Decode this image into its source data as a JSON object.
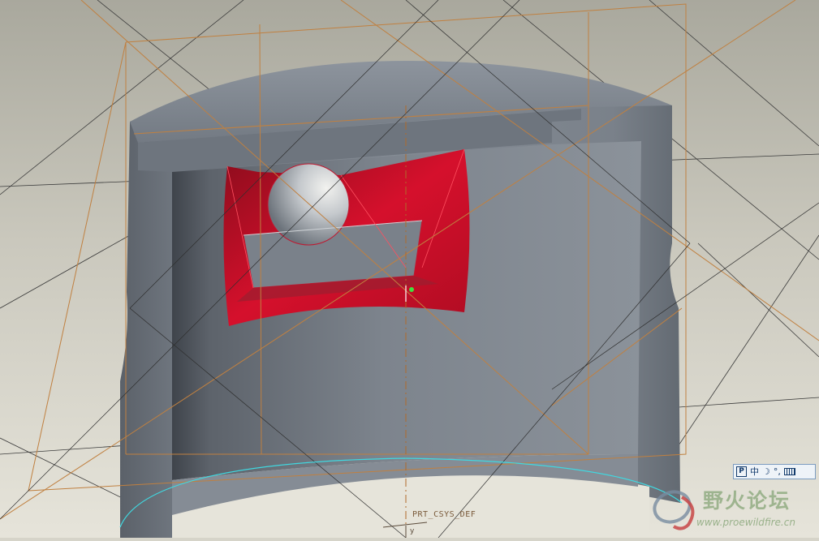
{
  "viewport": {
    "background": "#d6d4c9",
    "model_color": "#7f8791",
    "highlight_color": "#d0102a",
    "datum_color": "#c08040",
    "edge_highlight_color": "#40d8e0"
  },
  "csys": {
    "label": "PRT_CSYS_DEF",
    "axis_label": "y"
  },
  "ime_toolbar": {
    "logo": "P",
    "mode": "中",
    "width_mode": "☽",
    "punctuation": "°,",
    "keyboard_icon": "keyboard-icon"
  },
  "watermark": {
    "title": "野火论坛",
    "url": "www.proewildfire.cn"
  }
}
